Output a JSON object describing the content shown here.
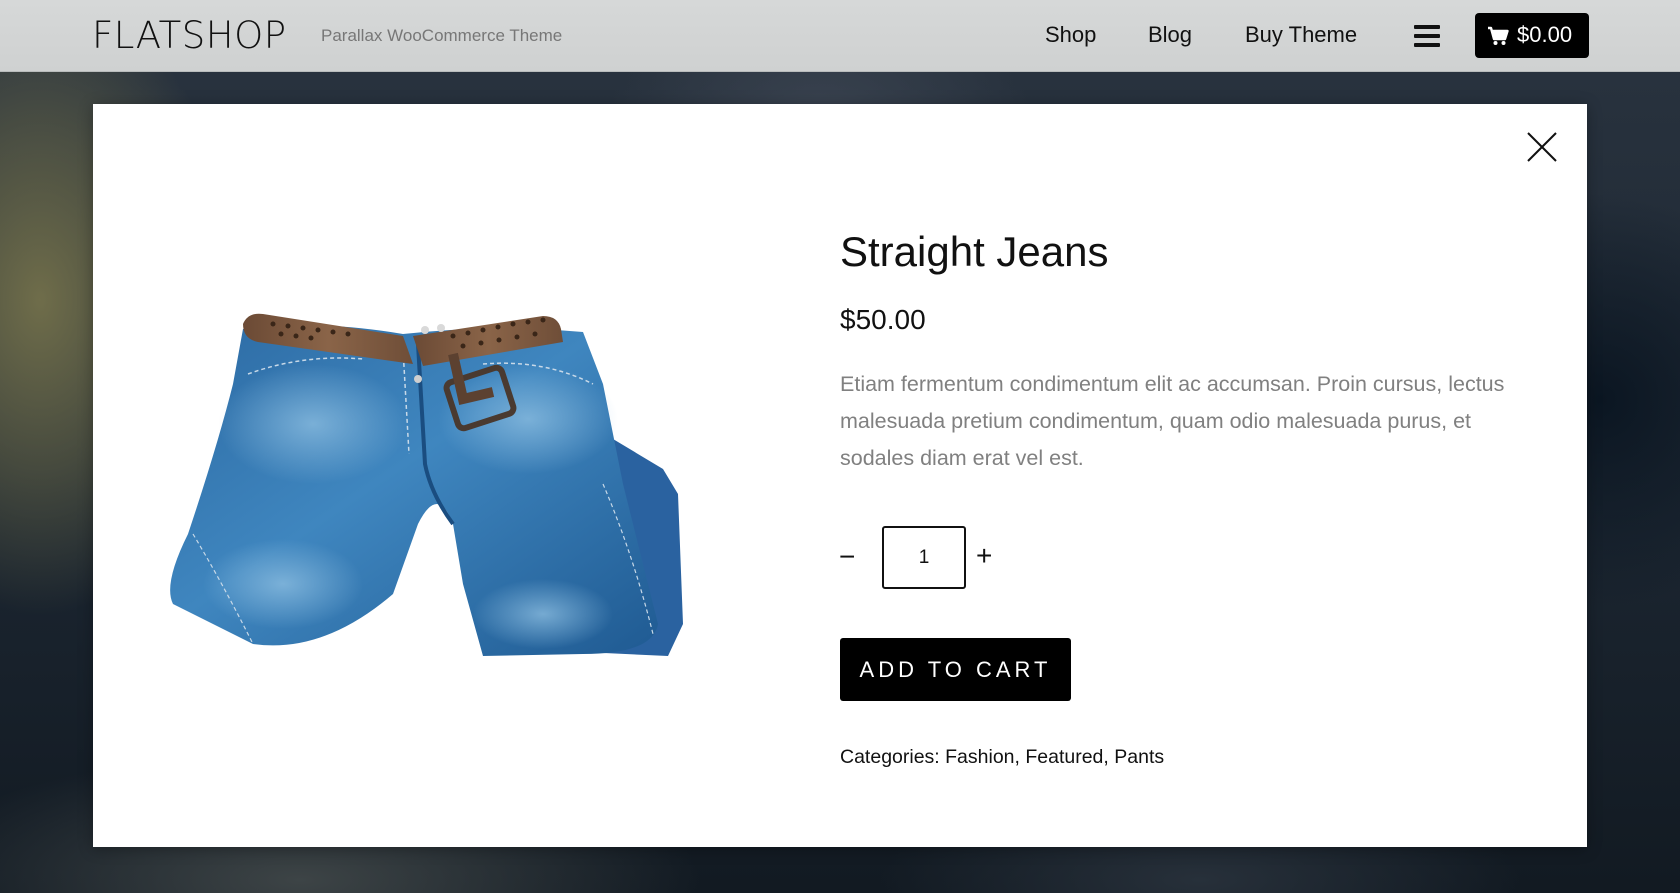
{
  "header": {
    "logo": "FLATSHOP",
    "tagline": "Parallax WooCommerce Theme",
    "nav": [
      {
        "label": "Shop"
      },
      {
        "label": "Blog"
      },
      {
        "label": "Buy Theme"
      }
    ],
    "menu_icon": "hamburger-menu-icon",
    "cart": {
      "icon": "shopping-cart-icon",
      "total": "$0.00"
    }
  },
  "modal": {
    "close_icon": "close-icon",
    "product": {
      "title": "Straight Jeans",
      "price": "$50.00",
      "description": "Etiam fermentum condimentum elit ac accumsan. Proin cursus, lectus malesuada pretium condimentum, quam odio malesuada purus, et sodales diam erat vel est.",
      "quantity": {
        "minus_label": "−",
        "value": "1",
        "plus_label": "+"
      },
      "add_to_cart_label": "ADD TO CART",
      "categories": {
        "label": "Categories:",
        "items": [
          "Fashion",
          "Featured",
          "Pants"
        ]
      }
    }
  },
  "colors": {
    "header_bg": "#d6d8d8",
    "accent_button": "#000000",
    "description_text": "#808080",
    "denim": "#2e6fa8"
  }
}
